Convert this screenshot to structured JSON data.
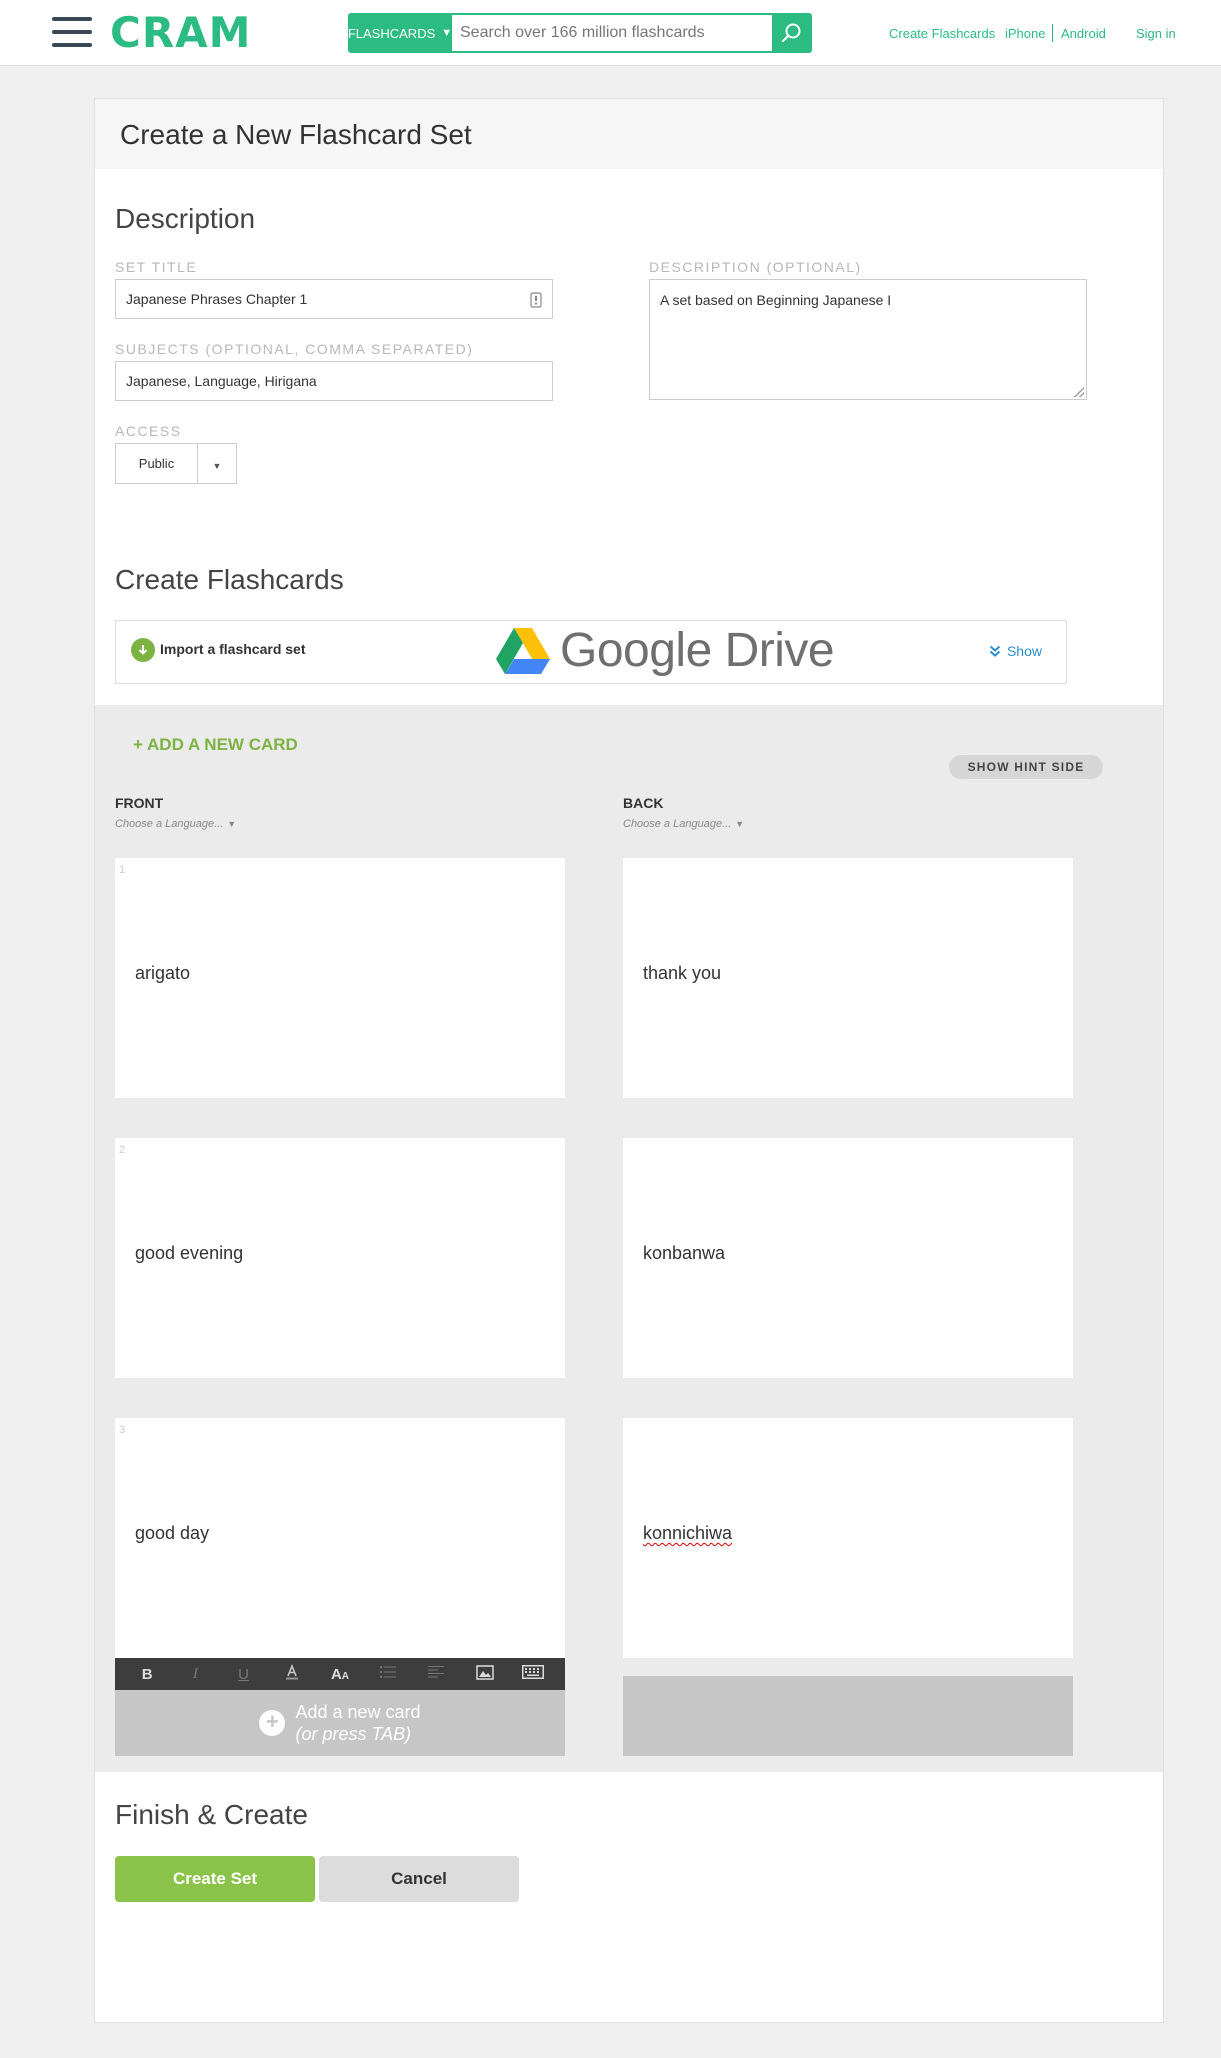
{
  "header": {
    "logo": "CRAM",
    "search_category": "FLASHCARDS",
    "search_placeholder": "Search over 166 million flashcards",
    "links": {
      "create": "Create Flashcards",
      "iphone": "iPhone",
      "android": "Android",
      "signin": "Sign in"
    }
  },
  "page": {
    "title": "Create a New Flashcard Set"
  },
  "description": {
    "heading": "Description",
    "set_title_label": "SET TITLE",
    "set_title_value": "Japanese Phrases Chapter 1",
    "subjects_label": "SUBJECTS (OPTIONAL, COMMA SEPARATED)",
    "subjects_value": "Japanese, Language, Hirigana",
    "access_label": "ACCESS",
    "access_value": "Public",
    "desc_label": "DESCRIPTION (OPTIONAL)",
    "desc_value": "A set based on Beginning Japanese I"
  },
  "create": {
    "heading": "Create Flashcards",
    "import_label": "Import a flashcard set",
    "gdrive_label": "Google Drive",
    "show_label": "Show",
    "add_new_card_top": "+ ADD A NEW CARD",
    "hint_button": "SHOW HINT SIDE",
    "front_header": "FRONT",
    "back_header": "BACK",
    "choose_language": "Choose a Language...",
    "cards": [
      {
        "num": "1",
        "front": "arigato",
        "back": "thank you"
      },
      {
        "num": "2",
        "front": "good evening",
        "back": "konbanwa"
      },
      {
        "num": "3",
        "front": "good day",
        "back": "konnichiwa"
      }
    ],
    "add_new_card": "Add a new card",
    "add_new_card_sub": "(or press TAB)"
  },
  "finish": {
    "heading": "Finish & Create",
    "create_button": "Create Set",
    "cancel_button": "Cancel"
  },
  "colors": {
    "brand_green": "#2bbb83",
    "action_green": "#8bc34a",
    "link_blue": "#2a8fcc"
  },
  "icons": [
    "menu-icon",
    "search-icon",
    "dropdown-arrow-icon",
    "download-icon",
    "google-drive-icon",
    "chevron-double-down-icon",
    "bold-icon",
    "italic-icon",
    "underline-icon",
    "text-color-icon",
    "font-size-icon",
    "list-icon",
    "align-icon",
    "image-icon",
    "keyboard-icon",
    "plus-circle-icon"
  ]
}
